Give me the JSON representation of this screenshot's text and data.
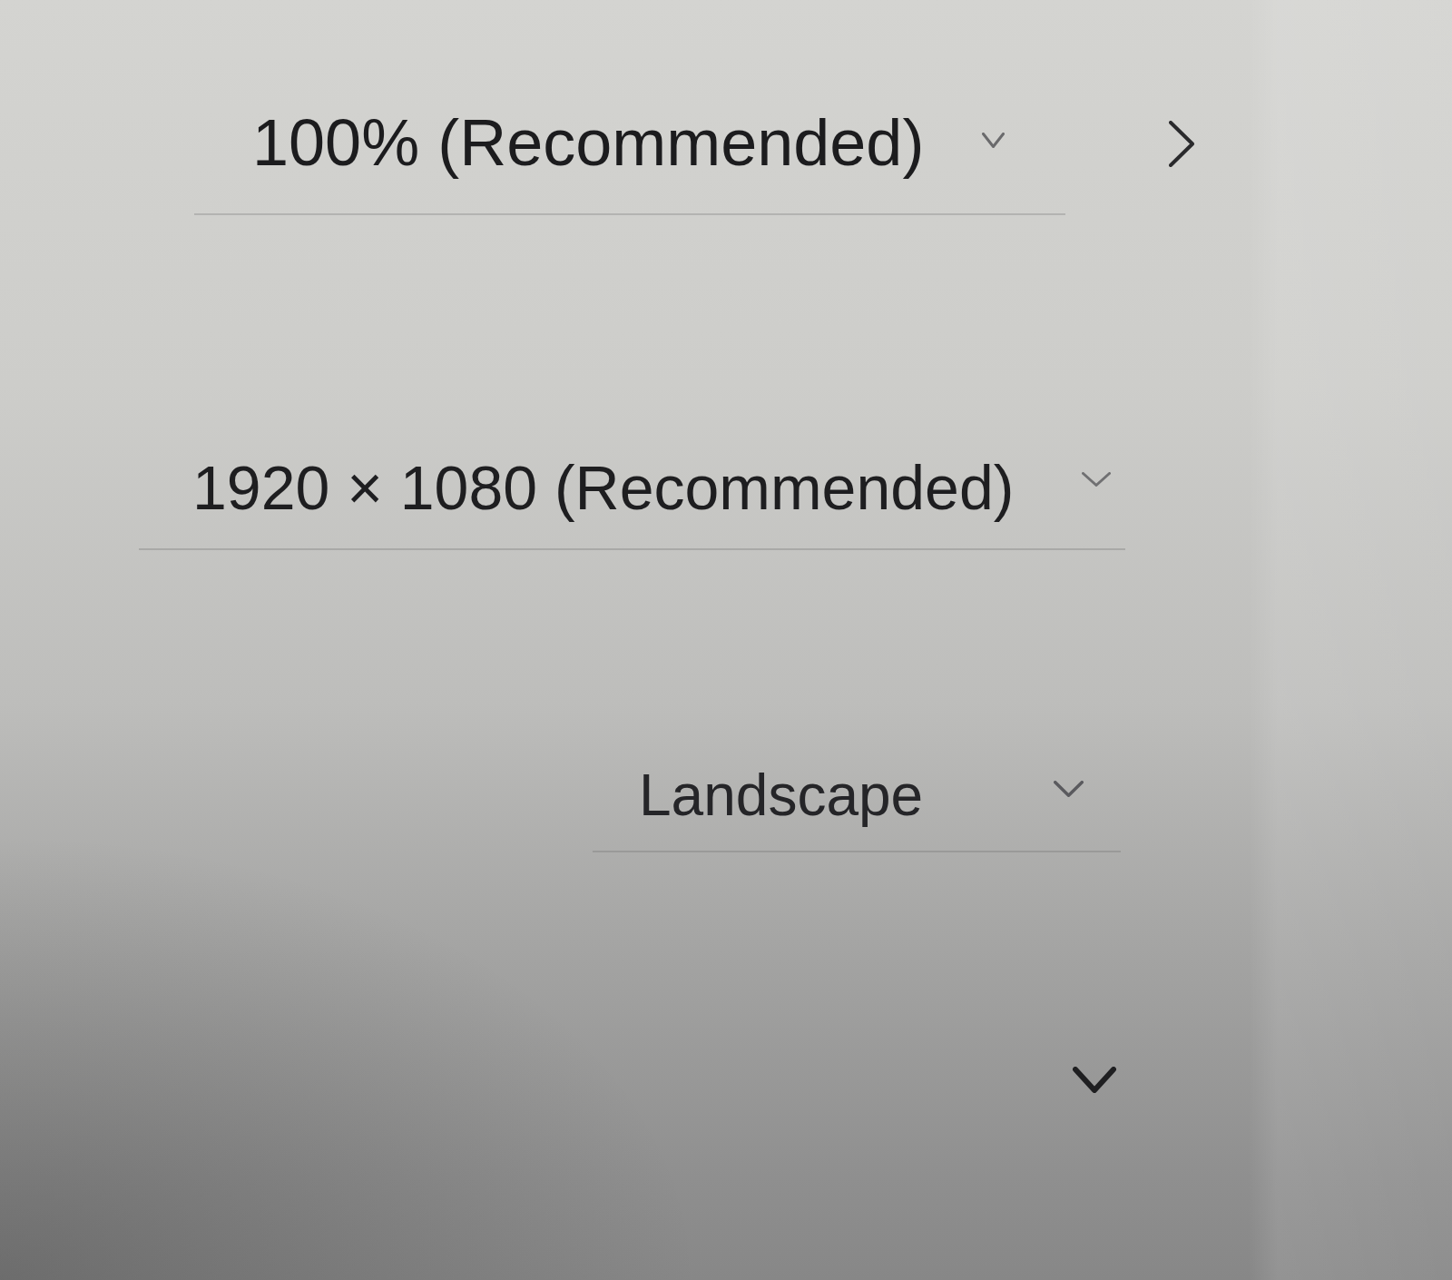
{
  "display_settings": {
    "rows": [
      {
        "kind": "dropdown-with-link",
        "value": "100% (Recommended)"
      },
      {
        "kind": "dropdown",
        "value": "1920 × 1080 (Recommended)"
      },
      {
        "kind": "dropdown",
        "value": "Landscape"
      },
      {
        "kind": "dropdown"
      }
    ]
  }
}
